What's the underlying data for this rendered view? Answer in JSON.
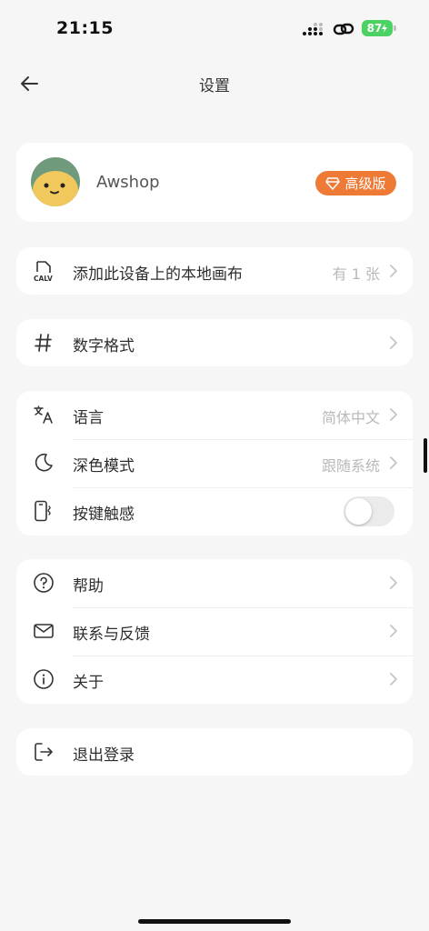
{
  "status_bar": {
    "time": "21:15",
    "battery": "87"
  },
  "header": {
    "title": "设置"
  },
  "profile": {
    "name": "Awshop",
    "badge_label": "高级版"
  },
  "local_canvas": {
    "label": "添加此设备上的本地画布",
    "value": "有 1 张"
  },
  "number_format": {
    "label": "数字格式"
  },
  "preferences": {
    "language": {
      "label": "语言",
      "value": "简体中文"
    },
    "dark_mode": {
      "label": "深色模式",
      "value": "跟随系统"
    },
    "haptics": {
      "label": "按键触感",
      "enabled": false
    }
  },
  "support": {
    "help": {
      "label": "帮助"
    },
    "contact": {
      "label": "联系与反馈"
    },
    "about": {
      "label": "关于"
    }
  },
  "logout": {
    "label": "退出登录"
  },
  "icons": {
    "back": "arrow-left-icon",
    "file": "calv-file-icon",
    "hash": "hash-icon",
    "language": "translate-icon",
    "dark_mode": "moon-icon",
    "haptics": "phone-vibrate-icon",
    "help": "question-circle-icon",
    "contact": "mail-icon",
    "about": "info-circle-icon",
    "logout": "logout-icon",
    "premium": "diamond-icon"
  },
  "colors": {
    "accent": "#ef7a36",
    "battery": "#4cd263",
    "avatar_face": "#f1c85c",
    "avatar_hair": "#6f9b7c"
  }
}
